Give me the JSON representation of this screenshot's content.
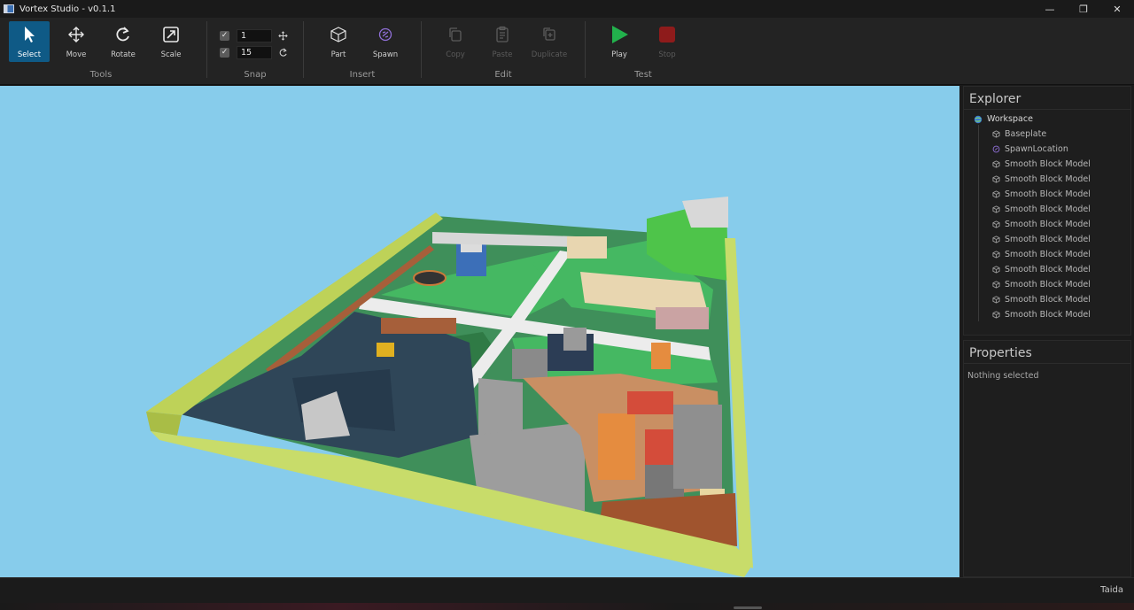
{
  "window": {
    "title": "Vortex Studio - v0.1.1",
    "minimize": "—",
    "maximize": "❐",
    "close": "✕"
  },
  "ribbon": {
    "tools": {
      "label": "Tools",
      "select": "Select",
      "move": "Move",
      "rotate": "Rotate",
      "scale": "Scale"
    },
    "snap": {
      "label": "Snap",
      "move_value": "1",
      "rotate_value": "15",
      "move_checked": true,
      "rotate_checked": true
    },
    "insert": {
      "label": "Insert",
      "part": "Part",
      "spawn": "Spawn"
    },
    "edit": {
      "label": "Edit",
      "copy": "Copy",
      "paste": "Paste",
      "duplicate": "Duplicate"
    },
    "test": {
      "label": "Test",
      "play": "Play",
      "stop": "Stop"
    }
  },
  "explorer": {
    "title": "Explorer",
    "root": "Workspace",
    "children": [
      "Baseplate",
      "SpawnLocation",
      "Smooth Block Model",
      "Smooth Block Model",
      "Smooth Block Model",
      "Smooth Block Model",
      "Smooth Block Model",
      "Smooth Block Model",
      "Smooth Block Model",
      "Smooth Block Model",
      "Smooth Block Model",
      "Smooth Block Model",
      "Smooth Block Model"
    ]
  },
  "properties": {
    "title": "Properties",
    "empty": "Nothing selected"
  },
  "status": {
    "user": "Taida"
  },
  "colors": {
    "accent": "#0f5a86",
    "sky": "#87cceb",
    "play": "#22b14c",
    "stop": "#8e1b1b",
    "wall": "#c8dc6a"
  }
}
